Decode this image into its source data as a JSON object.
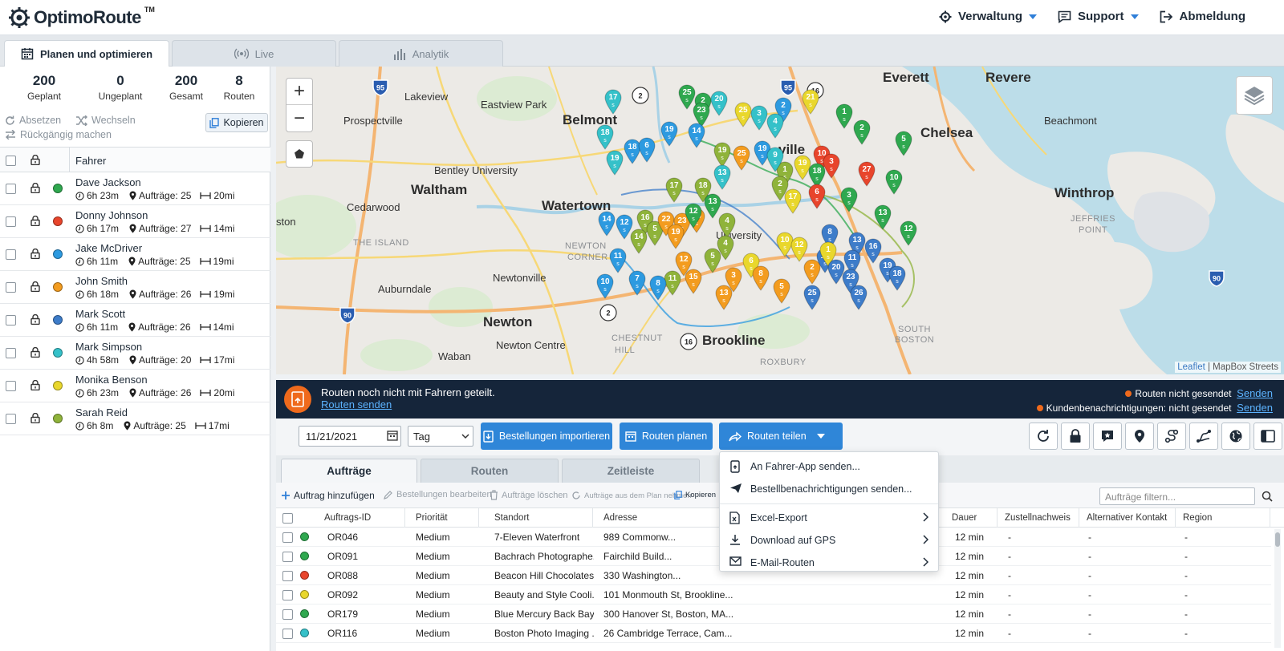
{
  "app": {
    "logo_text": "OptimoRoute",
    "logo_tm": "TM"
  },
  "topnav": {
    "admin": "Verwaltung",
    "support": "Support",
    "logout": "Abmeldung"
  },
  "main_tabs": [
    {
      "label": "Planen und optimieren",
      "active": true
    },
    {
      "label": "Live",
      "active": false
    },
    {
      "label": "Analytik",
      "active": false
    }
  ],
  "stats": [
    {
      "value": "200",
      "label": "Geplant"
    },
    {
      "value": "0",
      "label": "Ungeplant"
    },
    {
      "value": "200",
      "label": "Gesamt"
    },
    {
      "value": "8",
      "label": "Routen"
    }
  ],
  "actions": {
    "unassign": "Absetzen",
    "switch": "Wechseln",
    "undo": "Rückgängig machen",
    "copy": "Kopieren"
  },
  "drivers_header": "Fahrer",
  "drivers": [
    {
      "name": "Dave Jackson",
      "time": "6h 23m",
      "orders": "Aufträge: 25",
      "dist": "20mi",
      "color": "#2fa84f"
    },
    {
      "name": "Donny Johnson",
      "time": "6h 17m",
      "orders": "Aufträge: 27",
      "dist": "14mi",
      "color": "#e8452c"
    },
    {
      "name": "Jake McDriver",
      "time": "6h 11m",
      "orders": "Aufträge: 25",
      "dist": "19mi",
      "color": "#2d9ae0"
    },
    {
      "name": "John Smith",
      "time": "6h 18m",
      "orders": "Aufträge: 26",
      "dist": "19mi",
      "color": "#f39c1f"
    },
    {
      "name": "Mark Scott",
      "time": "6h 11m",
      "orders": "Aufträge: 26",
      "dist": "14mi",
      "color": "#3d7cc9"
    },
    {
      "name": "Mark Simpson",
      "time": "4h 58m",
      "orders": "Aufträge: 20",
      "dist": "17mi",
      "color": "#35c1c9"
    },
    {
      "name": "Monika Benson",
      "time": "6h 23m",
      "orders": "Aufträge: 26",
      "dist": "20mi",
      "color": "#e9d72c"
    },
    {
      "name": "Sarah Reid",
      "time": "6h 8m",
      "orders": "Aufträge: 25",
      "dist": "17mi",
      "color": "#8fb33a"
    }
  ],
  "map": {
    "zoom_in": "+",
    "zoom_out": "−",
    "attribution_leaflet": "Leaflet",
    "attribution_rest": " | MapBox Streets",
    "labels": [
      {
        "text": "Everett",
        "size": "big"
      },
      {
        "text": "Revere",
        "size": "big"
      },
      {
        "text": "Lakeview",
        "size": "small"
      },
      {
        "text": "Eastview Park",
        "size": "small"
      },
      {
        "text": "Prospectville",
        "size": "small"
      },
      {
        "text": "Belmont",
        "size": "big"
      },
      {
        "text": "Chelsea",
        "size": "big"
      },
      {
        "text": "Beachmont",
        "size": "small"
      },
      {
        "text": "Bentley University",
        "size": "small"
      },
      {
        "text": "Waltham",
        "size": "big"
      },
      {
        "text": "Watertown",
        "size": "big"
      },
      {
        "text": "Winthrop",
        "size": "big"
      },
      {
        "text": "Cedarwood",
        "size": "small"
      },
      {
        "text": "JEFFRIES",
        "size": "tiny"
      },
      {
        "text": "POINT",
        "size": "tiny"
      },
      {
        "text": "THE ISLAND",
        "size": "tiny"
      },
      {
        "text": "NEWTON",
        "size": "tiny"
      },
      {
        "text": "CORNER",
        "size": "tiny"
      },
      {
        "text": "Auburndale",
        "size": "small"
      },
      {
        "text": "Newtonville",
        "size": "small"
      },
      {
        "text": "Newton",
        "size": "big"
      },
      {
        "text": "Newton Centre",
        "size": "small"
      },
      {
        "text": "CHESTNUT",
        "size": "tiny"
      },
      {
        "text": "HILL",
        "size": "tiny"
      },
      {
        "text": "Brookline",
        "size": "big"
      },
      {
        "text": "SOUTH",
        "size": "tiny"
      },
      {
        "text": "BOSTON",
        "size": "tiny"
      },
      {
        "text": "Waban",
        "size": "small"
      },
      {
        "text": "ston",
        "size": "small"
      },
      {
        "text": "University",
        "size": "small"
      },
      {
        "text": "ville",
        "size": "big"
      },
      {
        "text": "ROXBURY",
        "size": "tiny"
      }
    ],
    "shields": [
      "95",
      "95",
      "16",
      "2",
      "16",
      "90",
      "16",
      "90",
      "2"
    ],
    "pins": [
      {
        "n": "25",
        "c": "#2fa84f"
      },
      {
        "n": "2",
        "c": "#2fa84f"
      },
      {
        "n": "20",
        "c": "#35c1c9"
      },
      {
        "n": "2",
        "c": "#2d9ae0"
      },
      {
        "n": "21",
        "c": "#e9d72c"
      },
      {
        "n": "17",
        "c": "#35c1c9"
      },
      {
        "n": "23",
        "c": "#2fa84f"
      },
      {
        "n": "25",
        "c": "#e9d72c"
      },
      {
        "n": "3",
        "c": "#35c1c9"
      },
      {
        "n": "4",
        "c": "#35c1c9"
      },
      {
        "n": "1",
        "c": "#2fa84f"
      },
      {
        "n": "2",
        "c": "#2fa84f"
      },
      {
        "n": "18",
        "c": "#35c1c9"
      },
      {
        "n": "19",
        "c": "#2d9ae0"
      },
      {
        "n": "14",
        "c": "#2d9ae0"
      },
      {
        "n": "5",
        "c": "#2fa84f"
      },
      {
        "n": "18",
        "c": "#2d9ae0"
      },
      {
        "n": "6",
        "c": "#2d9ae0"
      },
      {
        "n": "19",
        "c": "#8fb33a"
      },
      {
        "n": "25",
        "c": "#f39c1f"
      },
      {
        "n": "19",
        "c": "#35c1c9"
      },
      {
        "n": "10",
        "c": "#e8452c"
      },
      {
        "n": "3",
        "c": "#e8452c"
      },
      {
        "n": "27",
        "c": "#e8452c"
      },
      {
        "n": "19",
        "c": "#2d9ae0"
      },
      {
        "n": "1",
        "c": "#8fb33a"
      },
      {
        "n": "9",
        "c": "#35c1c9"
      },
      {
        "n": "19",
        "c": "#e9d72c"
      },
      {
        "n": "18",
        "c": "#2fa84f"
      },
      {
        "n": "10",
        "c": "#2fa84f"
      },
      {
        "n": "13",
        "c": "#35c1c9"
      },
      {
        "n": "2",
        "c": "#8fb33a"
      },
      {
        "n": "17",
        "c": "#8fb33a"
      },
      {
        "n": "18",
        "c": "#8fb33a"
      },
      {
        "n": "6",
        "c": "#e8452c"
      },
      {
        "n": "17",
        "c": "#e9d72c"
      },
      {
        "n": "3",
        "c": "#2fa84f"
      },
      {
        "n": "13",
        "c": "#2fa84f"
      },
      {
        "n": "12",
        "c": "#2fa84f"
      },
      {
        "n": "14",
        "c": "#2d9ae0"
      },
      {
        "n": "12",
        "c": "#2d9ae0"
      },
      {
        "n": "16",
        "c": "#8fb33a"
      },
      {
        "n": "5",
        "c": "#8fb33a"
      },
      {
        "n": "22",
        "c": "#f39c1f"
      },
      {
        "n": "23",
        "c": "#f39c1f"
      },
      {
        "n": "24",
        "c": "#f39c1f"
      },
      {
        "n": "4",
        "c": "#8fb33a"
      },
      {
        "n": "14",
        "c": "#8fb33a"
      },
      {
        "n": "19",
        "c": "#f39c1f"
      },
      {
        "n": "8",
        "c": "#3d7cc9"
      },
      {
        "n": "13",
        "c": "#3d7cc9"
      },
      {
        "n": "16",
        "c": "#3d7cc9"
      },
      {
        "n": "10",
        "c": "#e9d72c"
      },
      {
        "n": "12",
        "c": "#e9d72c"
      },
      {
        "n": "11",
        "c": "#2d9ae0"
      },
      {
        "n": "4",
        "c": "#8fb33a"
      },
      {
        "n": "5",
        "c": "#8fb33a"
      },
      {
        "n": "12",
        "c": "#f39c1f"
      },
      {
        "n": "6",
        "c": "#e9d72c"
      },
      {
        "n": "10",
        "c": "#3d7cc9"
      },
      {
        "n": "11",
        "c": "#3d7cc9"
      },
      {
        "n": "8",
        "c": "#f39c1f"
      },
      {
        "n": "2",
        "c": "#f39c1f"
      },
      {
        "n": "1",
        "c": "#e9d72c"
      },
      {
        "n": "20",
        "c": "#3d7cc9"
      },
      {
        "n": "19",
        "c": "#3d7cc9"
      },
      {
        "n": "7",
        "c": "#2d9ae0"
      },
      {
        "n": "11",
        "c": "#8fb33a"
      },
      {
        "n": "15",
        "c": "#f39c1f"
      },
      {
        "n": "3",
        "c": "#f39c1f"
      },
      {
        "n": "23",
        "c": "#3d7cc9"
      },
      {
        "n": "18",
        "c": "#3d7cc9"
      },
      {
        "n": "10",
        "c": "#2d9ae0"
      },
      {
        "n": "8",
        "c": "#2d9ae0"
      },
      {
        "n": "13",
        "c": "#f39c1f"
      },
      {
        "n": "5",
        "c": "#f39c1f"
      },
      {
        "n": "25",
        "c": "#3d7cc9"
      },
      {
        "n": "26",
        "c": "#3d7cc9"
      },
      {
        "n": "12",
        "c": "#2fa84f"
      },
      {
        "n": "13",
        "c": "#2fa84f"
      }
    ]
  },
  "notify": {
    "message": "Routen noch nicht mit Fahrern geteilt.",
    "link": "Routen senden",
    "routes_status": "Routen nicht gesendet",
    "customer_status": "Kundenbenachrichtigungen: nicht gesendet",
    "send": "Senden"
  },
  "toolbar": {
    "date": "11/21/2021",
    "period": "Tag",
    "import": "Bestellungen importieren",
    "plan": "Routen planen",
    "share": "Routen teilen"
  },
  "subtabs": [
    {
      "label": "Aufträge",
      "active": true
    },
    {
      "label": "Routen",
      "active": false
    },
    {
      "label": "Zeitleiste",
      "active": false
    }
  ],
  "order_actions": {
    "add": "Auftrag hinzufügen",
    "edit": "Bestellungen bearbeiten",
    "delete": "Aufträge löschen",
    "remove": "Aufträge aus dem Plan nehmen",
    "copy": "Kopieren",
    "filter_placeholder": "Aufträge filtern..."
  },
  "table": {
    "headers": [
      "Auftrags-ID",
      "Priorität",
      "Standort",
      "Adresse",
      "Dauer",
      "Zustellnachweis",
      "Alternativer Kontakt",
      "Region"
    ],
    "rows": [
      {
        "color": "#2fa84f",
        "id": "OR046",
        "prio": "Medium",
        "loc": "7-Eleven Waterfront",
        "addr": "989 Commonw...",
        "dur": "12 min",
        "pod": "-",
        "alt": "-",
        "reg": "-"
      },
      {
        "color": "#2fa84f",
        "id": "OR091",
        "prio": "Medium",
        "loc": "Bachrach Photographe...",
        "addr": "Fairchild Build...",
        "dur": "12 min",
        "pod": "-",
        "alt": "-",
        "reg": "-"
      },
      {
        "color": "#e8452c",
        "id": "OR088",
        "prio": "Medium",
        "loc": "Beacon Hill Chocolates...",
        "addr": "330 Washington...",
        "dur": "12 min",
        "pod": "-",
        "alt": "-",
        "reg": "-"
      },
      {
        "color": "#e9d72c",
        "id": "OR092",
        "prio": "Medium",
        "loc": "Beauty and Style Cooli...",
        "addr": "101 Monmouth St, Brookline...",
        "dur": "12 min",
        "pod": "-",
        "alt": "-",
        "reg": "-"
      },
      {
        "color": "#2fa84f",
        "id": "OR179",
        "prio": "Medium",
        "loc": "Blue Mercury Back Bay",
        "addr": "300 Hanover St, Boston, MA...",
        "dur": "12 min",
        "pod": "-",
        "alt": "-",
        "reg": "-"
      },
      {
        "color": "#35c1c9",
        "id": "OR116",
        "prio": "Medium",
        "loc": "Boston Photo Imaging ...",
        "addr": "26 Cambridge Terrace, Cam...",
        "dur": "12 min",
        "pod": "-",
        "alt": "-",
        "reg": "-"
      }
    ]
  },
  "dropdown": {
    "items": [
      {
        "label": "An Fahrer-App senden...",
        "icon": "phone-send-icon",
        "submenu": false
      },
      {
        "label": "Bestellbenachrichtigungen senden...",
        "icon": "paper-plane-icon",
        "submenu": false
      },
      {
        "label": "Excel-Export",
        "icon": "excel-file-icon",
        "submenu": true
      },
      {
        "label": "Download auf GPS",
        "icon": "download-icon",
        "submenu": true
      },
      {
        "label": "E-Mail-Routen",
        "icon": "mail-icon",
        "submenu": true
      }
    ]
  }
}
